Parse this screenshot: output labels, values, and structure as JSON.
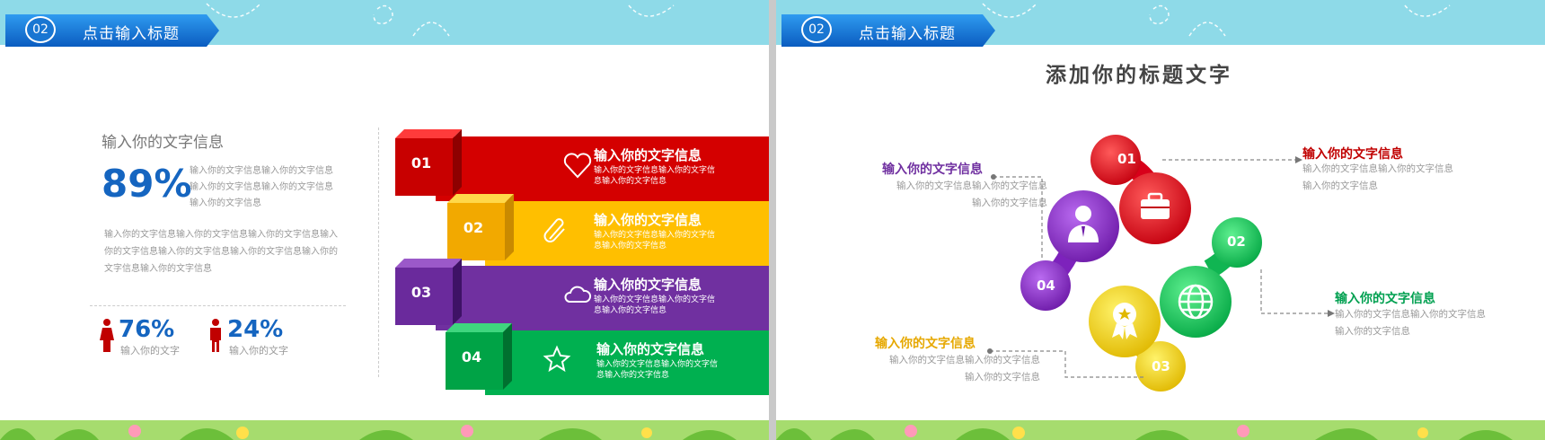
{
  "slide1": {
    "header": {
      "number": "02",
      "title": "点击输入标题"
    },
    "heading": "输入你的文字信息",
    "big_stat": {
      "value": "89%",
      "text": "输入你的文字信息输入你的文字信息输入你的文字信息输入你的文字信息输入你的文字信息"
    },
    "paragraph": "输入你的文字信息输入你的文字信息输入你的文字信息输入你的文字信息输入你的文字信息输入你的文字信息输入你的文字信息输入你的文字信息",
    "stats": [
      {
        "value": "76%",
        "label": "输入你的文字",
        "icon": "female-icon",
        "color": "#c00000"
      },
      {
        "value": "24%",
        "label": "输入你的文字",
        "icon": "male-icon",
        "color": "#c00000"
      }
    ],
    "items": [
      {
        "number": "01",
        "title": "输入你的文字信息",
        "desc": "输入你的文字信息输入你的文字信息输入你的文字信息",
        "icon": "heart-icon",
        "color": "#d40000"
      },
      {
        "number": "02",
        "title": "输入你的文字信息",
        "desc": "输入你的文字信息输入你的文字信息输入你的文字信息",
        "icon": "paperclip-icon",
        "color": "#ffbf00"
      },
      {
        "number": "03",
        "title": "输入你的文字信息",
        "desc": "输入你的文字信息输入你的文字信息输入你的文字信息",
        "icon": "cloud-icon",
        "color": "#7030a0"
      },
      {
        "number": "04",
        "title": "输入你的文字信息",
        "desc": "输入你的文字信息输入你的文字信息输入你的文字信息",
        "icon": "star-icon",
        "color": "#00b050"
      }
    ]
  },
  "slide2": {
    "header": {
      "number": "02",
      "title": "点击输入标题"
    },
    "title": "添加你的标题文字",
    "nodes": [
      {
        "number": "01",
        "icon": "briefcase-icon",
        "color": "#e0001b"
      },
      {
        "number": "02",
        "icon": "globe-icon",
        "color": "#12c15a"
      },
      {
        "number": "03",
        "icon": "award-icon",
        "color": "#f2d000"
      },
      {
        "number": "04",
        "icon": "person-icon",
        "color": "#8a2dc4"
      }
    ],
    "labels": [
      {
        "title": "输入你的文字信息",
        "desc": "输入你的文字信息输入你的文字信息输入你的文字信息",
        "color": "#7030a0"
      },
      {
        "title": "输入你的文字信息",
        "desc": "输入你的文字信息输入你的文字信息输入你的文字信息",
        "color": "#c00000"
      },
      {
        "title": "输入你的文字信息",
        "desc": "输入你的文字信息输入你的文字信息输入你的文字信息",
        "color": "#00a050"
      },
      {
        "title": "输入你的文字信息",
        "desc": "输入你的文字信息输入你的文字信息输入你的文字信息",
        "color": "#e6a800"
      }
    ]
  }
}
